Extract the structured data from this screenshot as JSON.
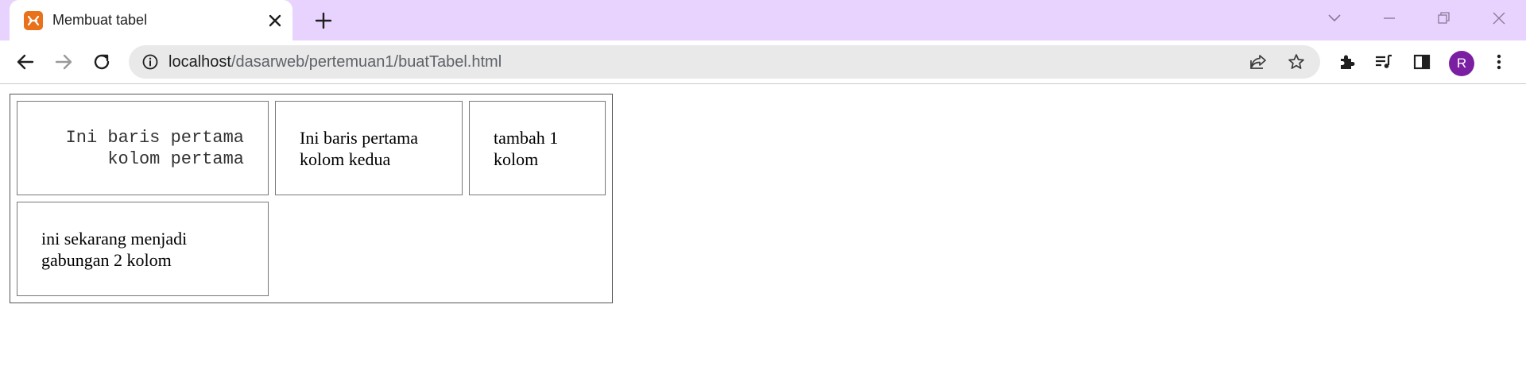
{
  "browser": {
    "tab_title": "Membuat tabel",
    "url_host": "localhost",
    "url_path": "/dasarweb/pertemuan1/buatTabel.html",
    "profile_initial": "R",
    "accent_color": "#e8d3fe",
    "favicon_color": "#e8711a",
    "avatar_color": "#7b1fa2"
  },
  "table": {
    "row1": {
      "cell1_line1": "Ini baris pertama",
      "cell1_line2": "kolom pertama",
      "cell2_line1": "Ini baris pertama",
      "cell2_line2": "kolom kedua",
      "cell3_line1": "tambah 1",
      "cell3_line2": "kolom"
    },
    "row2": {
      "cell1_line1": "ini sekarang menjadi",
      "cell1_line2": "gabungan 2 kolom"
    }
  }
}
